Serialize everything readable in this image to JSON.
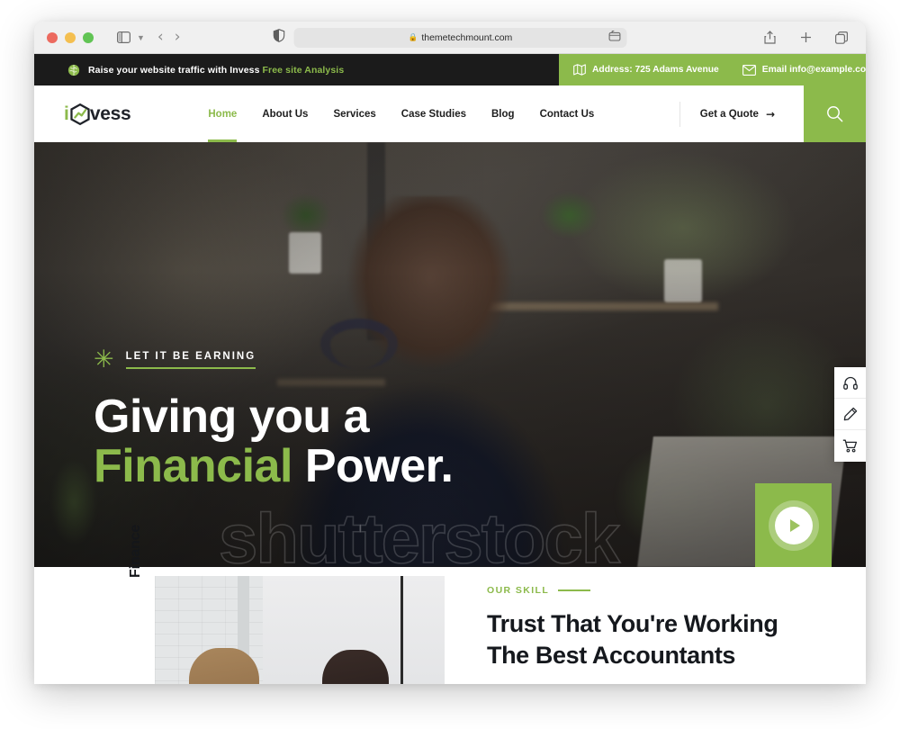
{
  "browser": {
    "url": "themetechmount.com",
    "lock_icon": "lock-icon",
    "shield_icon": "privacy-shield-icon",
    "sidebar_icon": "sidebar-toggle-icon",
    "back_icon": "back-arrow-icon",
    "forward_icon": "forward-arrow-icon",
    "reader_icon": "reader-mode-icon",
    "share_icon": "share-icon",
    "newtab_icon": "plus-icon",
    "tabs_icon": "tab-overview-icon",
    "traffic_lights": [
      "close",
      "minimize",
      "zoom"
    ]
  },
  "topbar": {
    "icon": "globe-icon",
    "promo_text": "Raise your website traffic with Invess ",
    "promo_link": "Free site Analysis",
    "address_icon": "map-icon",
    "address": "Address: 725 Adams Avenue",
    "email_icon": "envelope-icon",
    "email": "Email info@example.com"
  },
  "header": {
    "logo_i": "i",
    "logo_word": "vess",
    "logo_icon": "hexagon-chart-icon",
    "nav": [
      {
        "label": "Home",
        "active": true
      },
      {
        "label": "About Us",
        "active": false
      },
      {
        "label": "Services",
        "active": false
      },
      {
        "label": "Case Studies",
        "active": false
      },
      {
        "label": "Blog",
        "active": false
      },
      {
        "label": "Contact Us",
        "active": false
      }
    ],
    "quote_label": "Get a Quote",
    "quote_arrow": "→",
    "search_icon": "search-icon"
  },
  "hero": {
    "asterisk_icon": "asterisk-icon",
    "eyebrow": "LET IT BE EARNING",
    "title_line1": "Giving you a",
    "title_accent": "Financial",
    "title_rest": "Power.",
    "watermark": "shutterstock",
    "play_icon": "play-icon"
  },
  "dock": {
    "items": [
      {
        "icon": "headphones-icon",
        "name": "support"
      },
      {
        "icon": "pencil-icon",
        "name": "write"
      },
      {
        "icon": "cart-icon",
        "name": "cart"
      }
    ]
  },
  "bottom": {
    "vertical_label": "Finance",
    "eyebrow": "OUR SKILL",
    "heading_line1": "Trust That You're Working",
    "heading_line2": "The Best Accountants"
  },
  "colors": {
    "brand_green": "#8cba4b",
    "dark": "#1b1b1b",
    "text": "#15181d"
  }
}
